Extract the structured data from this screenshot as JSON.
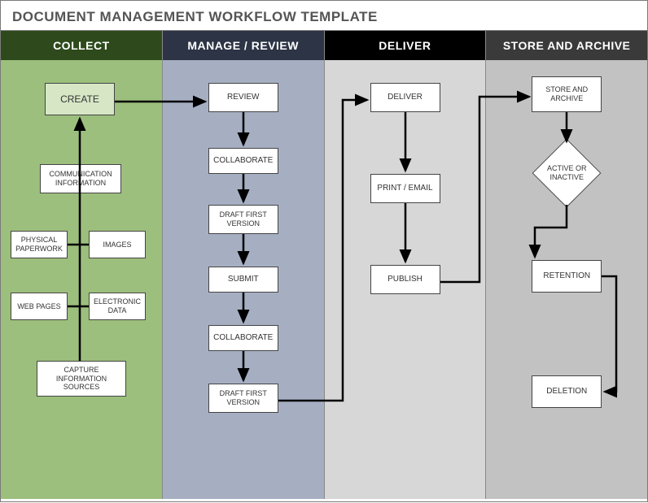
{
  "title": "DOCUMENT MANAGEMENT WORKFLOW TEMPLATE",
  "columns": {
    "collect": {
      "header": "COLLECT"
    },
    "manage": {
      "header": "MANAGE / REVIEW"
    },
    "deliver": {
      "header": "DELIVER"
    },
    "store": {
      "header": "STORE AND ARCHIVE"
    }
  },
  "nodes": {
    "create": "CREATE",
    "comm_info": "COMMUNICATION INFORMATION",
    "physical": "PHYSICAL PAPERWORK",
    "images": "IMAGES",
    "webpages": "WEB PAGES",
    "edata": "ELECTRONIC DATA",
    "capture": "CAPTURE INFORMATION SOURCES",
    "review": "REVIEW",
    "collab1": "COLLABORATE",
    "draft1": "DRAFT FIRST VERSION",
    "submit": "SUBMIT",
    "collab2": "COLLABORATE",
    "draft2": "DRAFT FIRST VERSION",
    "deliver": "DELIVER",
    "printemail": "PRINT / EMAIL",
    "publish": "PUBLISH",
    "storearchive": "STORE AND ARCHIVE",
    "decision": "ACTIVE OR INACTIVE",
    "retention": "RETENTION",
    "deletion": "DELETION"
  }
}
